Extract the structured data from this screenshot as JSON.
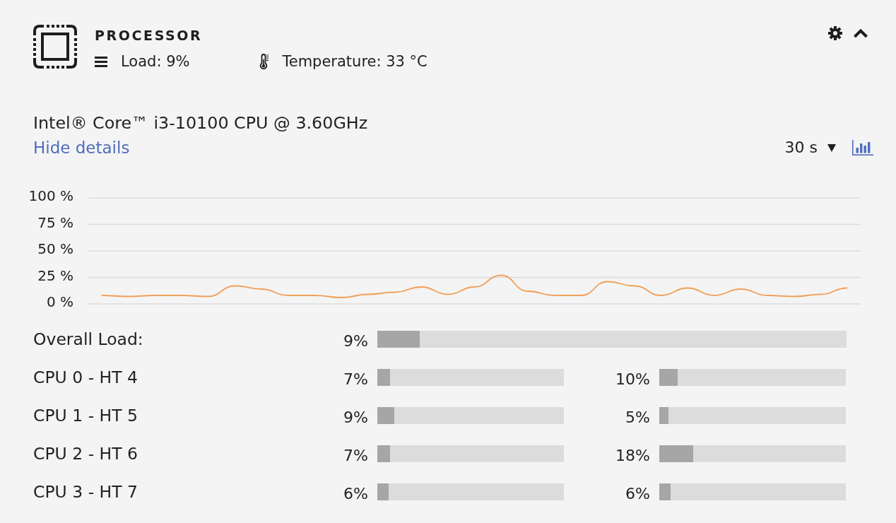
{
  "panel": {
    "title": "PROCESSOR",
    "load": "Load: 9%",
    "temperature": "Temperature: 33 °C",
    "expanded": true
  },
  "cpu_model": "Intel® Core™ i3-10100 CPU @ 3.60GHz",
  "details_link": "Hide details",
  "interval": "30 s",
  "chart_data": {
    "type": "line",
    "grid": true,
    "ylim": [
      0,
      100
    ],
    "yticks": [
      {
        "value": 0,
        "label": "0 %"
      },
      {
        "value": 25,
        "label": "25 %"
      },
      {
        "value": 50,
        "label": "50 %"
      },
      {
        "value": 75,
        "label": "75 %"
      },
      {
        "value": 100,
        "label": "100 %"
      }
    ],
    "categories": [
      null,
      null,
      null,
      null,
      null,
      null,
      null,
      null,
      null,
      null,
      null,
      null,
      null,
      null,
      null,
      null,
      null,
      null,
      null,
      null,
      null,
      null,
      null,
      null,
      null,
      null,
      null,
      null,
      null
    ],
    "series": [
      {
        "color": "#f0a05a",
        "values": [
          8,
          7,
          8,
          8,
          7,
          17,
          14,
          8,
          8,
          6,
          9,
          11,
          16,
          9,
          16,
          27,
          12,
          8,
          8,
          21,
          17,
          8,
          15,
          8,
          14,
          8,
          7,
          9,
          15
        ]
      }
    ]
  },
  "overall": {
    "label": "Overall Load:",
    "reading": "9%",
    "level": 0.09
  },
  "cores": [
    {
      "label": "CPU 0 - HT 4",
      "threads": [
        {
          "reading": "7%",
          "level": 0.07
        },
        {
          "reading": "10%",
          "level": 0.1
        }
      ]
    },
    {
      "label": "CPU 1 - HT 5",
      "threads": [
        {
          "reading": "9%",
          "level": 0.09
        },
        {
          "reading": "5%",
          "level": 0.05
        }
      ]
    },
    {
      "label": "CPU 2 - HT 6",
      "threads": [
        {
          "reading": "7%",
          "level": 0.07
        },
        {
          "reading": "18%",
          "level": 0.18
        }
      ]
    },
    {
      "label": "CPU 3 - HT 7",
      "threads": [
        {
          "reading": "6%",
          "level": 0.06
        },
        {
          "reading": "6%",
          "level": 0.06
        }
      ]
    }
  ]
}
